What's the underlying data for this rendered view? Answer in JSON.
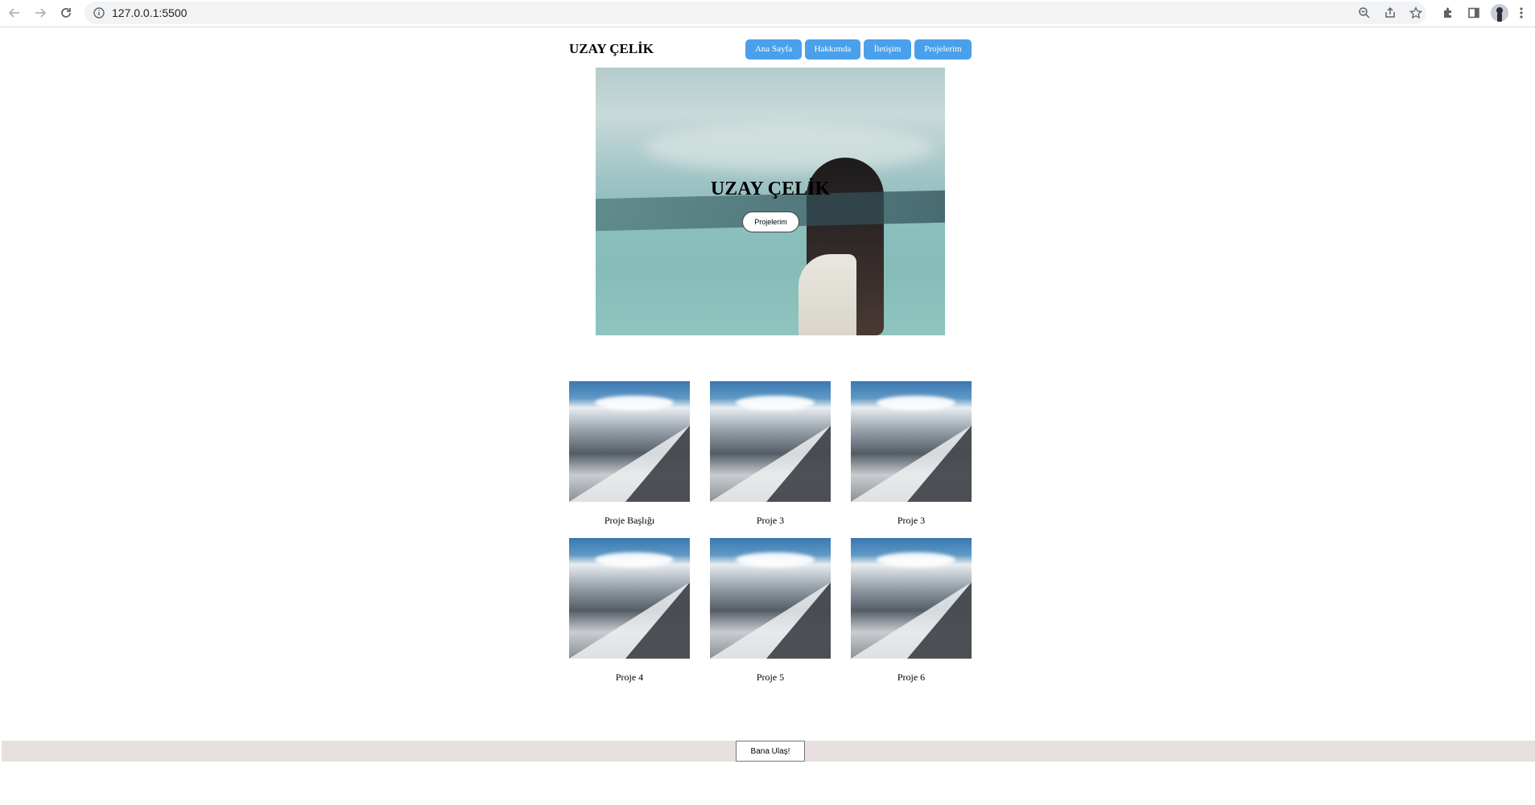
{
  "browser": {
    "url": "127.0.0.1:5500",
    "icons": [
      "back-arrow-icon",
      "forward-arrow-icon",
      "reload-icon",
      "site-info-icon",
      "zoom-icon",
      "share-icon",
      "bookmark-star-icon",
      "extensions-icon",
      "side-panel-icon",
      "profile-avatar",
      "menu-kebab-icon"
    ]
  },
  "header": {
    "brand": "UZAY ÇELİK",
    "nav": [
      "Ana Sayfa",
      "Hakkımda",
      "İletişim",
      "Projelerim"
    ]
  },
  "hero": {
    "title": "UZAY ÇELİK",
    "button": "Projelerim"
  },
  "projects": [
    {
      "title": "Proje Başlığı"
    },
    {
      "title": "Proje 3"
    },
    {
      "title": "Proje 3"
    },
    {
      "title": "Proje 4"
    },
    {
      "title": "Proje 5"
    },
    {
      "title": "Proje 6"
    }
  ],
  "footer": {
    "button": "Bana Ulaş!",
    "background": "#e8dfdf"
  },
  "colors": {
    "nav_button": "#4aa0ea"
  }
}
